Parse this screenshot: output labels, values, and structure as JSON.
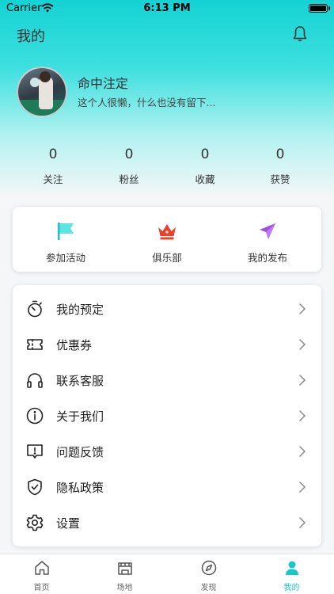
{
  "status_bar": {
    "carrier": "Carrier",
    "time": "6:13 PM"
  },
  "nav": {
    "title": "我的",
    "bell_icon": "bell-icon"
  },
  "profile": {
    "name": "命中注定",
    "bio": "这个人很懒，什么也没有留下..."
  },
  "stats": [
    {
      "value": "0",
      "label": "关注"
    },
    {
      "value": "0",
      "label": "粉丝"
    },
    {
      "value": "0",
      "label": "收藏"
    },
    {
      "value": "0",
      "label": "获赞"
    }
  ],
  "quick_actions": [
    {
      "label": "参加活动",
      "icon": "flag-icon",
      "color": "#2fd6d8"
    },
    {
      "label": "俱乐部",
      "icon": "crown-icon",
      "color": "#e8412c"
    },
    {
      "label": "我的发布",
      "icon": "paper-plane-icon",
      "color": "#a24ee6"
    }
  ],
  "menu": [
    {
      "label": "我的预定",
      "icon": "stopwatch-icon"
    },
    {
      "label": "优惠券",
      "icon": "ticket-icon"
    },
    {
      "label": "联系客服",
      "icon": "headphones-icon"
    },
    {
      "label": "关于我们",
      "icon": "info-icon"
    },
    {
      "label": "问题反馈",
      "icon": "feedback-icon"
    },
    {
      "label": "隐私政策",
      "icon": "shield-check-icon"
    },
    {
      "label": "设置",
      "icon": "gear-icon"
    }
  ],
  "tabs": [
    {
      "label": "首页",
      "icon": "home-icon",
      "active": false
    },
    {
      "label": "场地",
      "icon": "venue-icon",
      "active": false
    },
    {
      "label": "发现",
      "icon": "compass-icon",
      "active": false
    },
    {
      "label": "我的",
      "icon": "person-icon",
      "active": true
    }
  ],
  "colors": {
    "accent": "#19c7c9",
    "header_gradient_top": "#14d2d4"
  }
}
